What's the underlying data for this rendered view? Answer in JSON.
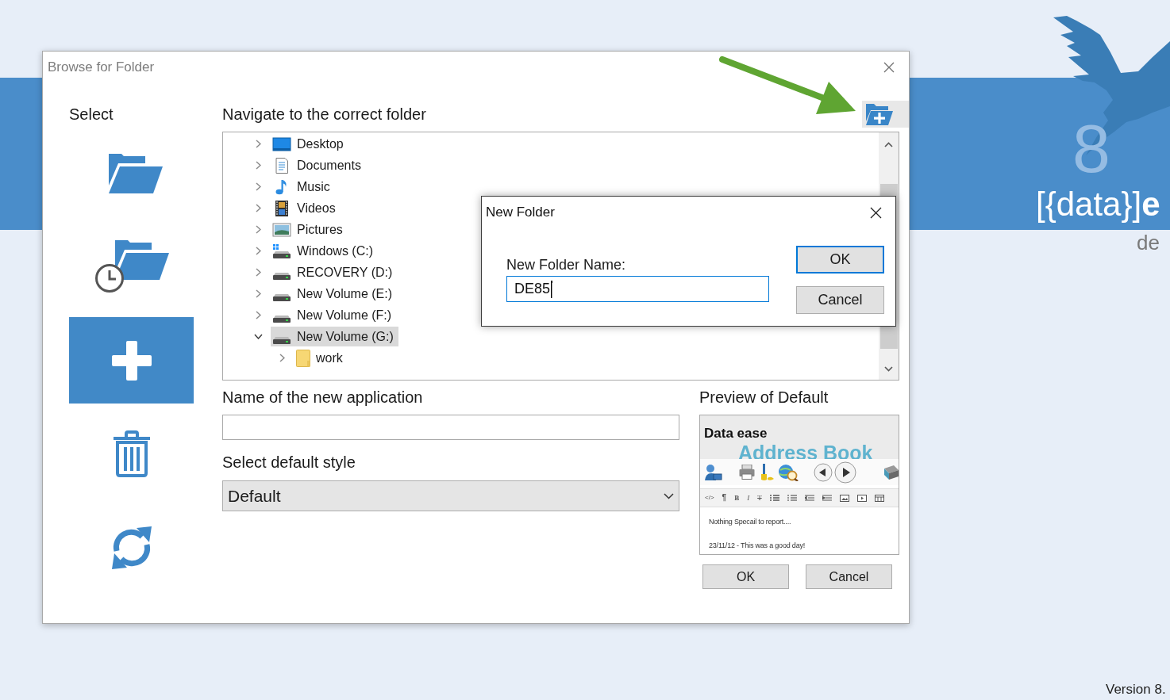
{
  "desktop": {
    "logo": {
      "numeral": "8",
      "wordmark": "[{data}]",
      "wordmark_bold": "e",
      "tagline": "de"
    },
    "version": "Version 8."
  },
  "browse_dialog": {
    "title": "Browse for Folder",
    "sidebar": {
      "heading": "Select",
      "items": [
        {
          "kind": "open",
          "selected": false
        },
        {
          "kind": "recent",
          "selected": false
        },
        {
          "kind": "new",
          "selected": true
        },
        {
          "kind": "delete",
          "selected": false
        },
        {
          "kind": "refresh",
          "selected": false
        }
      ]
    },
    "navigator": {
      "heading": "Navigate to the correct folder",
      "tree": [
        {
          "label": "Desktop",
          "kind": "desktop",
          "expanded": false,
          "selected": false
        },
        {
          "label": "Documents",
          "kind": "documents",
          "expanded": false,
          "selected": false
        },
        {
          "label": "Music",
          "kind": "music",
          "expanded": false,
          "selected": false
        },
        {
          "label": "Videos",
          "kind": "videos",
          "expanded": false,
          "selected": false
        },
        {
          "label": "Pictures",
          "kind": "pictures",
          "expanded": false,
          "selected": false
        },
        {
          "label": "Windows (C:)",
          "kind": "system_drive",
          "expanded": false,
          "selected": false
        },
        {
          "label": "RECOVERY (D:)",
          "kind": "drive",
          "expanded": false,
          "selected": false
        },
        {
          "label": "New Volume (E:)",
          "kind": "drive",
          "expanded": false,
          "selected": false
        },
        {
          "label": "New Volume (F:)",
          "kind": "drive",
          "expanded": false,
          "selected": false
        },
        {
          "label": "New Volume (G:)",
          "kind": "drive",
          "expanded": true,
          "selected": true,
          "children": [
            {
              "label": "work",
              "kind": "folder",
              "expanded": false,
              "selected": false
            }
          ]
        }
      ]
    },
    "name_field": {
      "label": "Name of the new application"
    },
    "style_select": {
      "label": "Select default style",
      "value": "Default"
    },
    "preview": {
      "heading": "Preview of Default",
      "screenshot": {
        "logo": "Data ease",
        "title": "Address Book",
        "format_tools": [
          {
            "kind": "code",
            "label": "</>"
          },
          {
            "kind": "paragraph",
            "label": "¶"
          },
          {
            "kind": "bold",
            "label": "B"
          },
          {
            "kind": "italic",
            "label": "I"
          },
          {
            "kind": "strike",
            "label": "T"
          }
        ],
        "notes": [
          "Nothing Specail to report....",
          "23/11/12 - This was a good day!"
        ]
      }
    },
    "buttons": [
      "OK",
      "Cancel"
    ]
  },
  "new_folder_dialog": {
    "title": "New Folder",
    "field_label": "New Folder Name:",
    "value": "DE85",
    "buttons": [
      {
        "label": "OK",
        "default": true
      },
      {
        "label": "Cancel",
        "default": false
      }
    ]
  }
}
